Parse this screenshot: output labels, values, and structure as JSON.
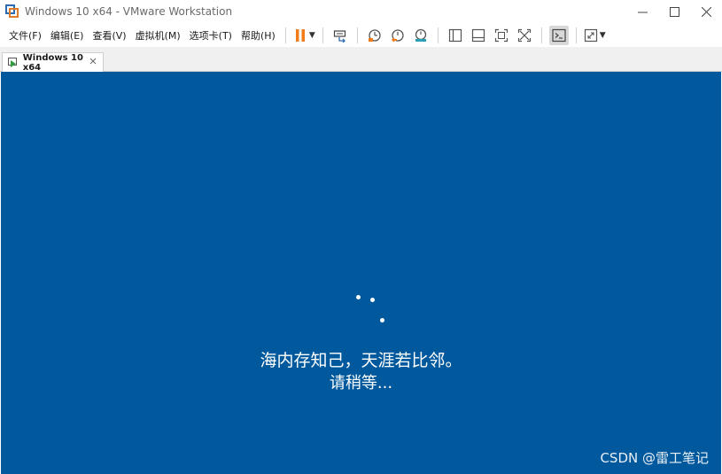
{
  "window": {
    "title": "Windows 10 x64 - VMware Workstation"
  },
  "menu": [
    "文件(F)",
    "编辑(E)",
    "查看(V)",
    "虚拟机(M)",
    "选项卡(T)",
    "帮助(H)"
  ],
  "toolbar": {
    "icons": [
      "pause-icon",
      "send-ctrl-alt-del-icon",
      "snapshot-icon",
      "revert-snapshot-icon",
      "snapshot-manager-icon",
      "library-icon",
      "thumbnail-icon",
      "full-screen-icon",
      "unity-icon",
      "console-icon",
      "stretch-icon"
    ],
    "accent": "#f07c1c"
  },
  "tab": {
    "label": "Windows 10 x64"
  },
  "guest": {
    "background": "#00599d",
    "line1": "海内存知己，天涯若比邻。",
    "line2": "请稍等..."
  },
  "watermark": "CSDN @雷工笔记"
}
